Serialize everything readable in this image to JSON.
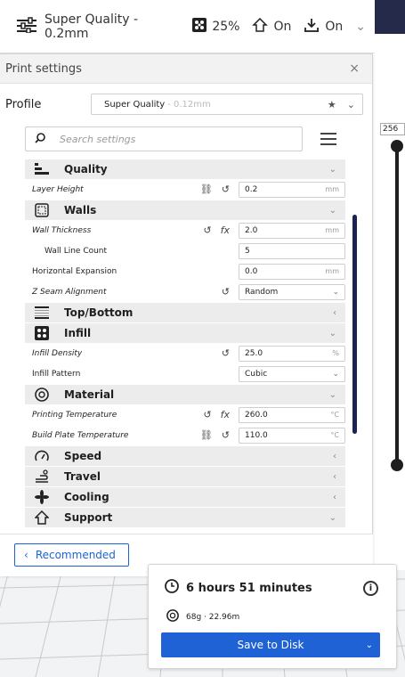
{
  "toolbar": {
    "profile": "Super Quality - 0.2mm",
    "infill": "25%",
    "support": "On",
    "adhesion": "On"
  },
  "panel": {
    "title": "Print settings",
    "close": "×",
    "profile_label": "Profile",
    "profile_value": "Super Quality",
    "profile_suffix": " - 0.12mm",
    "search_placeholder": "Search settings"
  },
  "categories": {
    "quality": "Quality",
    "walls": "Walls",
    "topbottom": "Top/Bottom",
    "infill": "Infill",
    "material": "Material",
    "speed": "Speed",
    "travel": "Travel",
    "cooling": "Cooling",
    "support": "Support"
  },
  "settings": {
    "layer_height": {
      "label": "Layer Height",
      "value": "0.2",
      "unit": "mm"
    },
    "wall_thickness": {
      "label": "Wall Thickness",
      "value": "2.0",
      "unit": "mm"
    },
    "wall_line_count": {
      "label": "Wall Line Count",
      "value": "5"
    },
    "horizontal_expansion": {
      "label": "Horizontal Expansion",
      "value": "0.0",
      "unit": "mm"
    },
    "z_seam": {
      "label": "Z Seam Alignment",
      "value": "Random"
    },
    "infill_density": {
      "label": "Infill Density",
      "value": "25.0",
      "unit": "%"
    },
    "infill_pattern": {
      "label": "Infill Pattern",
      "value": "Cubic"
    },
    "print_temp": {
      "label": "Printing Temperature",
      "value": "260.0",
      "unit": "°C"
    },
    "bed_temp": {
      "label": "Build Plate Temperature",
      "value": "110.0",
      "unit": "°C"
    }
  },
  "footer": {
    "recommended": "Recommended"
  },
  "slider": {
    "top_layer": "256"
  },
  "print_info": {
    "time": "6 hours 51 minutes",
    "material": "68g · 22.96m",
    "save": "Save to Disk"
  }
}
